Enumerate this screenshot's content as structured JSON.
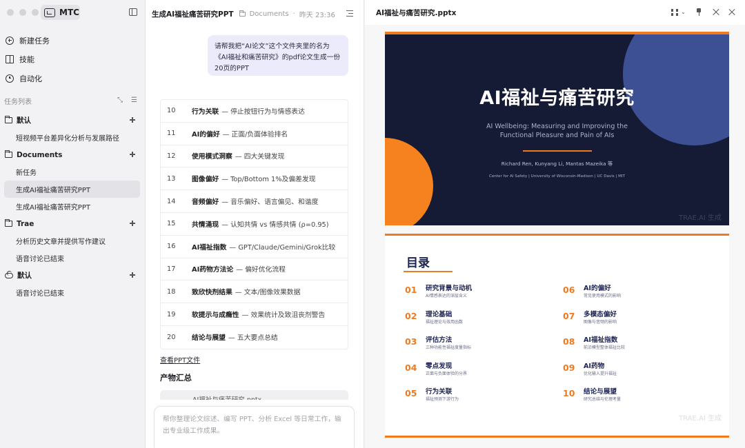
{
  "sidebar": {
    "brand": "MTC",
    "nav": [
      {
        "label": "新建任务",
        "icon": "plus-circle-icon"
      },
      {
        "label": "技能",
        "icon": "book-icon"
      },
      {
        "label": "自动化",
        "icon": "clock-icon"
      }
    ],
    "section_label": "任务列表",
    "groups": [
      {
        "label": "默认",
        "icon": "folder-icon",
        "items": [
          "短视频平台差异化分析与发展路径"
        ]
      },
      {
        "label": "Documents",
        "icon": "folder-icon",
        "items": [
          "新任务",
          "生成AI福祉痛苦研究PPT",
          "生成AI福祉痛苦研究PPT"
        ]
      },
      {
        "label": "Trae",
        "icon": "folder-icon",
        "items": [
          "分析历史文章并提供写作建议",
          "语音讨论已结束"
        ]
      },
      {
        "label": "默认",
        "icon": "cloud-icon",
        "items": [
          "语音讨论已结束"
        ]
      }
    ]
  },
  "chat": {
    "title": "生成AI福祉痛苦研究PPT",
    "folder": "Documents",
    "timestamp": "昨天 23:36",
    "user_message": "请帮我把“AI论文”这个文件夹里的名为《AI福祉和痛苦研究》的pdf论文生成一份20页的PPT",
    "slides": [
      {
        "num": "10",
        "title": "行为关联",
        "desc": "— 停止按钮行为与情感表达"
      },
      {
        "num": "11",
        "title": "AI的偏好",
        "desc": "— 正面/负面体验排名"
      },
      {
        "num": "12",
        "title": "使用模式洞察",
        "desc": "— 四大关键发现"
      },
      {
        "num": "13",
        "title": "图像偏好",
        "desc": "— Top/Bottom 1%及偏差发现"
      },
      {
        "num": "14",
        "title": "音频偏好",
        "desc": "— 音乐偏好、语言偏见、和谐度"
      },
      {
        "num": "15",
        "title": "共情涌现",
        "desc": "— 认知共情 vs 情感共情 (ρ=0.95)"
      },
      {
        "num": "16",
        "title": "AI福祉指数",
        "desc": "— GPT/Claude/Gemini/Grok比较"
      },
      {
        "num": "17",
        "title": "AI药物方法论",
        "desc": "— 偏好优化流程"
      },
      {
        "num": "18",
        "title": "致欣快剂结果",
        "desc": "— 文本/图像效果数据"
      },
      {
        "num": "19",
        "title": "软提示与成瘾性",
        "desc": "— 效果统计及致沮丧剂警告"
      },
      {
        "num": "20",
        "title": "结论与展望",
        "desc": "— 五大要点总结"
      }
    ],
    "view_link": "查看PPT文件",
    "products_title": "产物汇总",
    "product_card_label": "AI福祉与痛苦研究.pptx",
    "composer_placeholder": "帮你整理论文综述、编写 PPT、分析 Excel 等日常工作，输出专业级工作成果。"
  },
  "preview": {
    "file_title": "AI福祉与痛苦研究.pptx",
    "slide1": {
      "title": "AI福祉与痛苦研究",
      "subtitle_line1": "AI Wellbeing: Measuring and Improving the",
      "subtitle_line2": "Functional Pleasure and Pain of AIs",
      "authors": "Richard Ren, Kunyang Li, Mantas Mazeika 等",
      "affiliation": "Center for AI Safety | University of Wisconsin-Madison | UC Davis | MIT",
      "watermark": "TRAE.AI 生成"
    },
    "slide2": {
      "title": "目录",
      "watermark": "TRAE.AI 生成",
      "items": [
        {
          "num": "01",
          "main": "研究背景与动机",
          "sub": "AI情感表达的深层含义"
        },
        {
          "num": "02",
          "main": "理论基础",
          "sub": "福祉理论与效用函数"
        },
        {
          "num": "03",
          "main": "评估方法",
          "sub": "三种功能性福祉度量指标"
        },
        {
          "num": "04",
          "main": "零点发现",
          "sub": "正面与负面体验的分界"
        },
        {
          "num": "05",
          "main": "行为关联",
          "sub": "福祉预测下游行为"
        },
        {
          "num": "06",
          "main": "AI的偏好",
          "sub": "常见使用模式的影响"
        },
        {
          "num": "07",
          "main": "多模态偏好",
          "sub": "图像与音频的影响"
        },
        {
          "num": "08",
          "main": "AI福祉指数",
          "sub": "前沿模型整体福祉比较"
        },
        {
          "num": "09",
          "main": "AI药物",
          "sub": "优化输入提升福祉"
        },
        {
          "num": "10",
          "main": "结论与展望",
          "sub": "研究总结与伦理考量"
        }
      ]
    }
  },
  "colors": {
    "accent": "#f07a1e",
    "slide_bg": "#151a35",
    "slide_circle": "#3d5093",
    "bubble": "#ecebfc"
  }
}
